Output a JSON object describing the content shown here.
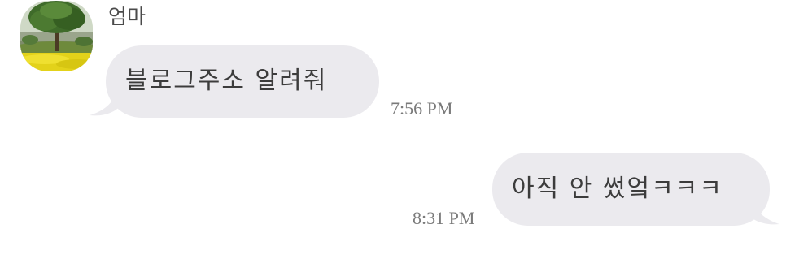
{
  "chat": {
    "contact_name": "엄마",
    "colors": {
      "bubble": "#ebeaee",
      "text": "#3c3c3c",
      "timestamp": "#7a7a7a",
      "background": "#ffffff"
    },
    "messages": [
      {
        "direction": "incoming",
        "text": "블로그주소 알려줘",
        "time": "7:56 PM"
      },
      {
        "direction": "outgoing",
        "text": "아직 안 썼엌ㅋㅋㅋ",
        "time": "8:31 PM"
      }
    ],
    "avatar_icon": "tree-photo-avatar"
  }
}
